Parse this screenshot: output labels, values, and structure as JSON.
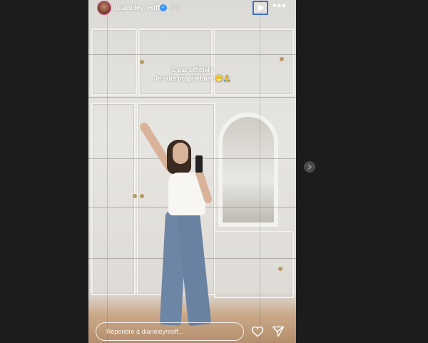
{
  "header": {
    "username": "dianeleyreoff",
    "time_ago": "4 h"
  },
  "story": {
    "caption_line1": "C'est officiel !",
    "caption_line2": "Je suis propriétaire 😁🙏"
  },
  "footer": {
    "reply_placeholder": "Répondre à dianeleyreoff..."
  },
  "icons": {
    "play": "play-icon",
    "more": "more-icon",
    "heart": "heart-icon",
    "send": "send-icon",
    "next": "chevron-right-icon",
    "verified": "verified-badge-icon"
  },
  "colors": {
    "background": "#1c1c1c",
    "verified": "#3b95ff",
    "play_outline": "#3b6ed8"
  }
}
